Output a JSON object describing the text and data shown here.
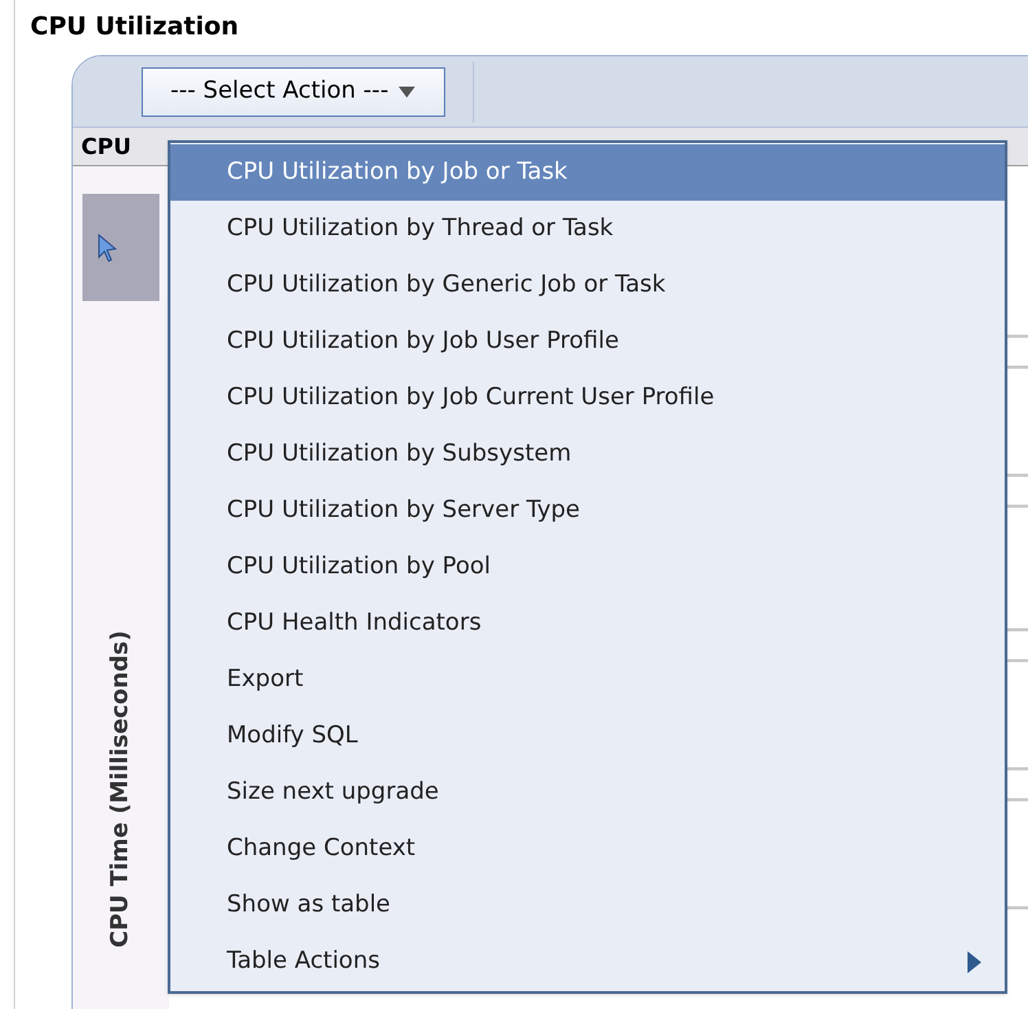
{
  "title": "CPU Utilization",
  "toolbar": {
    "select_action": "--- Select Action ---"
  },
  "chart_header": "CPU",
  "chart": {
    "ylabel": "CPU Time (Milliseconds)"
  },
  "menu": [
    {
      "label": "CPU Utilization by Job or Task",
      "selected": true,
      "kind": "item"
    },
    {
      "label": "CPU Utilization by Thread or Task",
      "selected": false,
      "kind": "item"
    },
    {
      "label": "CPU Utilization by Generic Job or Task",
      "selected": false,
      "kind": "item"
    },
    {
      "label": "CPU Utilization by Job User Profile",
      "selected": false,
      "kind": "item"
    },
    {
      "label": "CPU Utilization by Job Current User Profile",
      "selected": false,
      "kind": "item"
    },
    {
      "label": "CPU Utilization by Subsystem",
      "selected": false,
      "kind": "item"
    },
    {
      "label": "CPU Utilization by Server Type",
      "selected": false,
      "kind": "item"
    },
    {
      "label": "CPU Utilization by Pool",
      "selected": false,
      "kind": "item"
    },
    {
      "label": "CPU Health Indicators",
      "selected": false,
      "kind": "item"
    },
    {
      "label": "Export",
      "selected": false,
      "kind": "item"
    },
    {
      "label": "Modify SQL",
      "selected": false,
      "kind": "item"
    },
    {
      "label": "Size next upgrade",
      "selected": false,
      "kind": "item"
    },
    {
      "label": "Change Context",
      "selected": false,
      "kind": "item"
    },
    {
      "label": "Show as table",
      "selected": false,
      "kind": "item"
    },
    {
      "label": "Table Actions",
      "selected": false,
      "kind": "submenu"
    }
  ]
}
